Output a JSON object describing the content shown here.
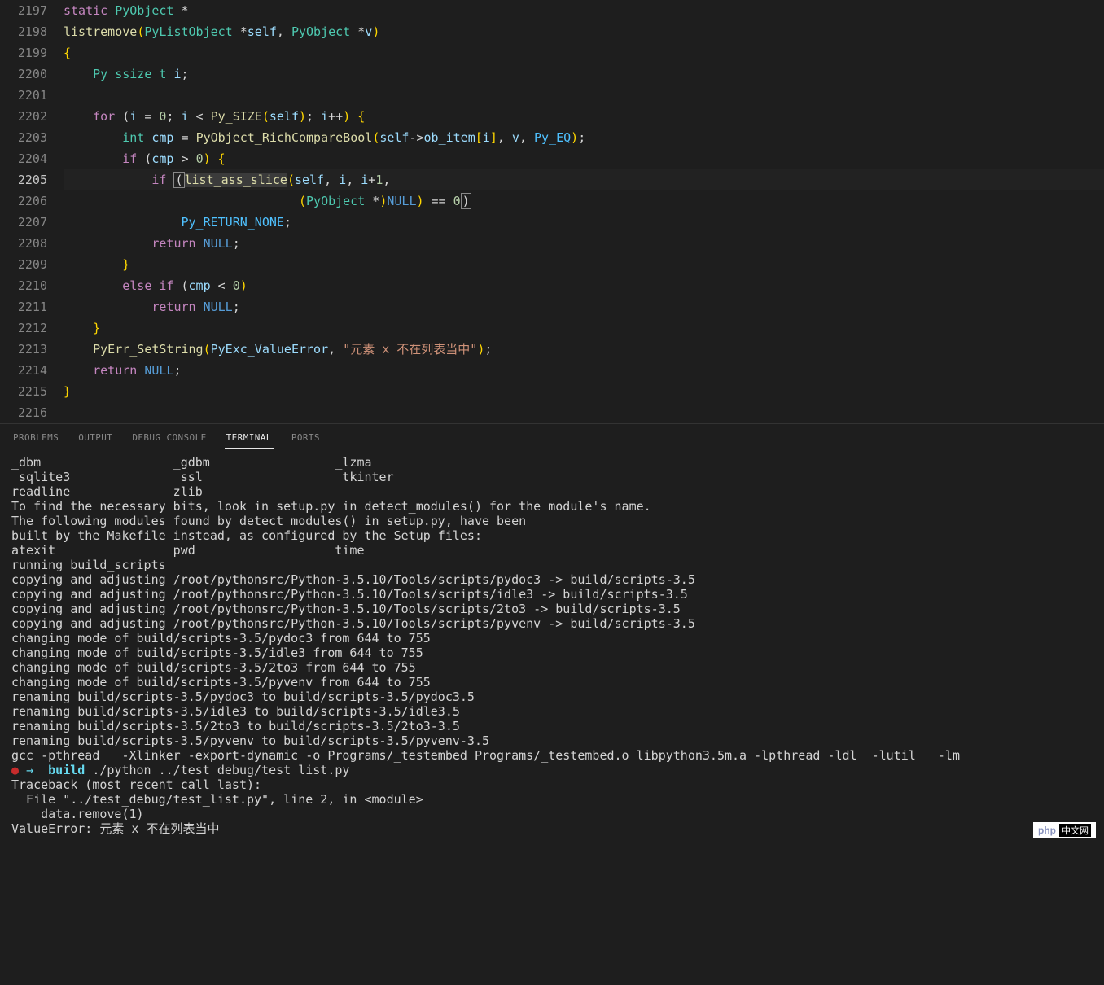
{
  "editor": {
    "startLine": 2197,
    "activeLine": 2205,
    "lines": [
      {
        "n": 2197,
        "tokens": [
          {
            "t": "static",
            "c": "kw"
          },
          {
            "t": " "
          },
          {
            "t": "PyObject",
            "c": "type"
          },
          {
            "t": " *",
            "c": "op"
          }
        ]
      },
      {
        "n": 2198,
        "tokens": [
          {
            "t": "listremove",
            "c": "fn"
          },
          {
            "t": "(",
            "c": "punc"
          },
          {
            "t": "PyListObject",
            "c": "type"
          },
          {
            "t": " *",
            "c": "op"
          },
          {
            "t": "self",
            "c": "var"
          },
          {
            "t": ", ",
            "c": "op"
          },
          {
            "t": "PyObject",
            "c": "type"
          },
          {
            "t": " *",
            "c": "op"
          },
          {
            "t": "v",
            "c": "var"
          },
          {
            "t": ")",
            "c": "punc"
          }
        ]
      },
      {
        "n": 2199,
        "tokens": [
          {
            "t": "{",
            "c": "punc"
          }
        ]
      },
      {
        "n": 2200,
        "indent": 1,
        "tokens": [
          {
            "t": "Py_ssize_t",
            "c": "type"
          },
          {
            "t": " "
          },
          {
            "t": "i",
            "c": "var"
          },
          {
            "t": ";",
            "c": "op"
          }
        ]
      },
      {
        "n": 2201,
        "tokens": []
      },
      {
        "n": 2202,
        "indent": 1,
        "tokens": [
          {
            "t": "for",
            "c": "kw"
          },
          {
            "t": " ("
          },
          {
            "t": "i",
            "c": "var"
          },
          {
            "t": " = "
          },
          {
            "t": "0",
            "c": "num"
          },
          {
            "t": "; "
          },
          {
            "t": "i",
            "c": "var"
          },
          {
            "t": " < "
          },
          {
            "t": "Py_SIZE",
            "c": "fn"
          },
          {
            "t": "(",
            "c": "punc"
          },
          {
            "t": "self",
            "c": "var"
          },
          {
            "t": ")",
            "c": "punc"
          },
          {
            "t": "; "
          },
          {
            "t": "i",
            "c": "var"
          },
          {
            "t": "++",
            "c": "op"
          },
          {
            "t": ")",
            "c": "punc"
          },
          {
            "t": " "
          },
          {
            "t": "{",
            "c": "punc"
          }
        ]
      },
      {
        "n": 2203,
        "indent": 2,
        "tokens": [
          {
            "t": "int",
            "c": "type"
          },
          {
            "t": " "
          },
          {
            "t": "cmp",
            "c": "var"
          },
          {
            "t": " = "
          },
          {
            "t": "PyObject_RichCompareBool",
            "c": "fn"
          },
          {
            "t": "(",
            "c": "punc"
          },
          {
            "t": "self",
            "c": "var"
          },
          {
            "t": "->",
            "c": "op"
          },
          {
            "t": "ob_item",
            "c": "member"
          },
          {
            "t": "[",
            "c": "punc"
          },
          {
            "t": "i",
            "c": "var"
          },
          {
            "t": "]",
            "c": "punc"
          },
          {
            "t": ", "
          },
          {
            "t": "v",
            "c": "var"
          },
          {
            "t": ", "
          },
          {
            "t": "Py_EQ",
            "c": "const"
          },
          {
            "t": ")",
            "c": "punc"
          },
          {
            "t": ";",
            "c": "op"
          }
        ]
      },
      {
        "n": 2204,
        "indent": 2,
        "tokens": [
          {
            "t": "if",
            "c": "kw"
          },
          {
            "t": " ("
          },
          {
            "t": "cmp",
            "c": "var"
          },
          {
            "t": " > "
          },
          {
            "t": "0",
            "c": "num"
          },
          {
            "t": ")",
            "c": "punc"
          },
          {
            "t": " "
          },
          {
            "t": "{",
            "c": "punc"
          }
        ]
      },
      {
        "n": 2205,
        "indent": 3,
        "active": true,
        "tokens": [
          {
            "t": "if",
            "c": "kw"
          },
          {
            "t": " "
          },
          {
            "t": "(",
            "c": "box"
          },
          {
            "t": "list_ass_slice",
            "c": "fn hl"
          },
          {
            "t": "(",
            "c": "punc"
          },
          {
            "t": "self",
            "c": "var"
          },
          {
            "t": ", "
          },
          {
            "t": "i",
            "c": "var"
          },
          {
            "t": ", "
          },
          {
            "t": "i",
            "c": "var"
          },
          {
            "t": "+"
          },
          {
            "t": "1",
            "c": "num"
          },
          {
            "t": ","
          }
        ]
      },
      {
        "n": 2206,
        "indent": 8,
        "tokens": [
          {
            "t": "(",
            "c": "punc"
          },
          {
            "t": "PyObject",
            "c": "type"
          },
          {
            "t": " *",
            "c": "op"
          },
          {
            "t": ")",
            "c": "punc"
          },
          {
            "t": "NULL",
            "c": "null"
          },
          {
            "t": ")",
            "c": "punc"
          },
          {
            "t": " == "
          },
          {
            "t": "0",
            "c": "num"
          },
          {
            "t": ")",
            "c": "box"
          }
        ]
      },
      {
        "n": 2207,
        "indent": 4,
        "tokens": [
          {
            "t": "Py_RETURN_NONE",
            "c": "const"
          },
          {
            "t": ";",
            "c": "op"
          }
        ]
      },
      {
        "n": 2208,
        "indent": 3,
        "tokens": [
          {
            "t": "return",
            "c": "kw"
          },
          {
            "t": " "
          },
          {
            "t": "NULL",
            "c": "null"
          },
          {
            "t": ";",
            "c": "op"
          }
        ]
      },
      {
        "n": 2209,
        "indent": 2,
        "tokens": [
          {
            "t": "}",
            "c": "punc"
          }
        ]
      },
      {
        "n": 2210,
        "indent": 2,
        "tokens": [
          {
            "t": "else",
            "c": "kw"
          },
          {
            "t": " "
          },
          {
            "t": "if",
            "c": "kw"
          },
          {
            "t": " ("
          },
          {
            "t": "cmp",
            "c": "var"
          },
          {
            "t": " < "
          },
          {
            "t": "0",
            "c": "num"
          },
          {
            "t": ")",
            "c": "punc"
          }
        ]
      },
      {
        "n": 2211,
        "indent": 3,
        "tokens": [
          {
            "t": "return",
            "c": "kw"
          },
          {
            "t": " "
          },
          {
            "t": "NULL",
            "c": "null"
          },
          {
            "t": ";",
            "c": "op"
          }
        ]
      },
      {
        "n": 2212,
        "indent": 1,
        "tokens": [
          {
            "t": "}",
            "c": "punc"
          }
        ]
      },
      {
        "n": 2213,
        "indent": 1,
        "tokens": [
          {
            "t": "PyErr_SetString",
            "c": "fn"
          },
          {
            "t": "(",
            "c": "punc"
          },
          {
            "t": "PyExc_ValueError",
            "c": "var"
          },
          {
            "t": ", "
          },
          {
            "t": "\"元素 x 不在列表当中\"",
            "c": "str"
          },
          {
            "t": ")",
            "c": "punc"
          },
          {
            "t": ";",
            "c": "op"
          }
        ]
      },
      {
        "n": 2214,
        "indent": 1,
        "tokens": [
          {
            "t": "return",
            "c": "kw"
          },
          {
            "t": " "
          },
          {
            "t": "NULL",
            "c": "null"
          },
          {
            "t": ";",
            "c": "op"
          }
        ]
      },
      {
        "n": 2215,
        "tokens": [
          {
            "t": "}",
            "c": "punc"
          }
        ]
      },
      {
        "n": 2216,
        "tokens": []
      }
    ]
  },
  "panel": {
    "tabs": [
      "PROBLEMS",
      "OUTPUT",
      "DEBUG CONSOLE",
      "TERMINAL",
      "PORTS"
    ],
    "activeTab": "TERMINAL"
  },
  "terminal": {
    "lines": [
      "_dbm                  _gdbm                 _lzma",
      "_sqlite3              _ssl                  _tkinter",
      "readline              zlib",
      "To find the necessary bits, look in setup.py in detect_modules() for the module's name.",
      "",
      "The following modules found by detect_modules() in setup.py, have been",
      "built by the Makefile instead, as configured by the Setup files:",
      "atexit                pwd                   time",
      "running build_scripts",
      "copying and adjusting /root/pythonsrc/Python-3.5.10/Tools/scripts/pydoc3 -> build/scripts-3.5",
      "copying and adjusting /root/pythonsrc/Python-3.5.10/Tools/scripts/idle3 -> build/scripts-3.5",
      "copying and adjusting /root/pythonsrc/Python-3.5.10/Tools/scripts/2to3 -> build/scripts-3.5",
      "copying and adjusting /root/pythonsrc/Python-3.5.10/Tools/scripts/pyvenv -> build/scripts-3.5",
      "changing mode of build/scripts-3.5/pydoc3 from 644 to 755",
      "changing mode of build/scripts-3.5/idle3 from 644 to 755",
      "changing mode of build/scripts-3.5/2to3 from 644 to 755",
      "changing mode of build/scripts-3.5/pyvenv from 644 to 755",
      "renaming build/scripts-3.5/pydoc3 to build/scripts-3.5/pydoc3.5",
      "renaming build/scripts-3.5/idle3 to build/scripts-3.5/idle3.5",
      "renaming build/scripts-3.5/2to3 to build/scripts-3.5/2to3-3.5",
      "renaming build/scripts-3.5/pyvenv to build/scripts-3.5/pyvenv-3.5",
      "gcc -pthread   -Xlinker -export-dynamic -o Programs/_testembed Programs/_testembed.o libpython3.5m.a -lpthread -ldl  -lutil   -lm"
    ],
    "prompt": {
      "dot": "●",
      "arrow": "→",
      "dir": "build",
      "cmd": "./python ../test_debug/test_list.py"
    },
    "traceback": [
      "Traceback (most recent call last):",
      "  File \"../test_debug/test_list.py\", line 2, in <module>",
      "    data.remove(1)",
      "ValueError: 元素 x 不在列表当中"
    ]
  },
  "badge": {
    "brand": "php",
    "cn": "中文网"
  }
}
